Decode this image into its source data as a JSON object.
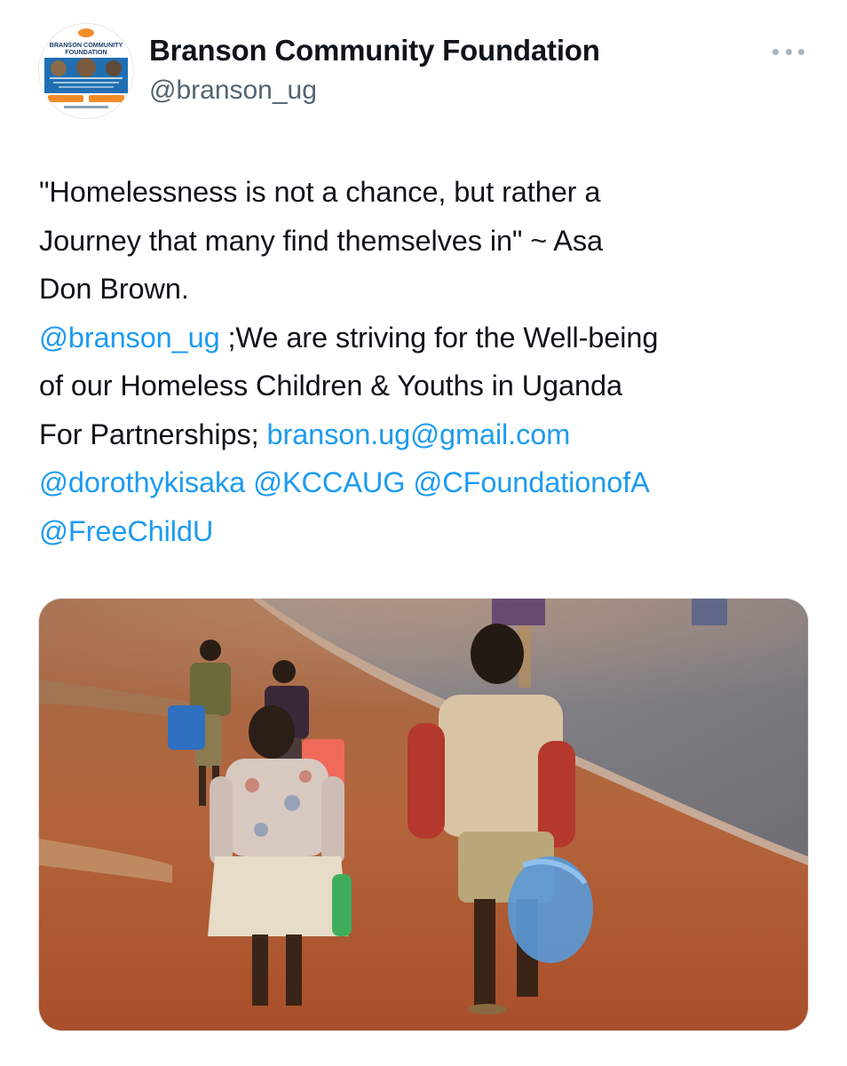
{
  "author": {
    "display_name": "Branson Community Foundation",
    "handle": "@branson_ug",
    "avatar": {
      "logo_title": "BRANSON COMMUNITY",
      "logo_subtitle": "FOUNDATION",
      "brand_colors": [
        "#1f6fb2",
        "#f28c28"
      ]
    }
  },
  "more_menu": {
    "icon": "more-horizontal-icon"
  },
  "tweet": {
    "quote_line1": "\"Homelessness is not a chance, but rather a",
    "quote_line2": "Journey that many find themselves in\" ~ Asa",
    "quote_line3": "Don Brown.",
    "mention_branson": "@branson_ug",
    "line4_rest": " ;We are striving for the Well-being",
    "line5": "of our Homeless Children & Youths in Uganda",
    "line6_prefix": "For Partnerships; ",
    "email": "branson.ug@gmail.com",
    "mention_dorothy": "@dorothykisaka",
    "mention_kcca": "@KCCAUG",
    "mention_cfoundation": "@CFoundationofA",
    "mention_freechild": "@FreeChildU"
  },
  "colors": {
    "text": "#0f1419",
    "link": "#1d9bf0",
    "secondary": "#536471"
  }
}
